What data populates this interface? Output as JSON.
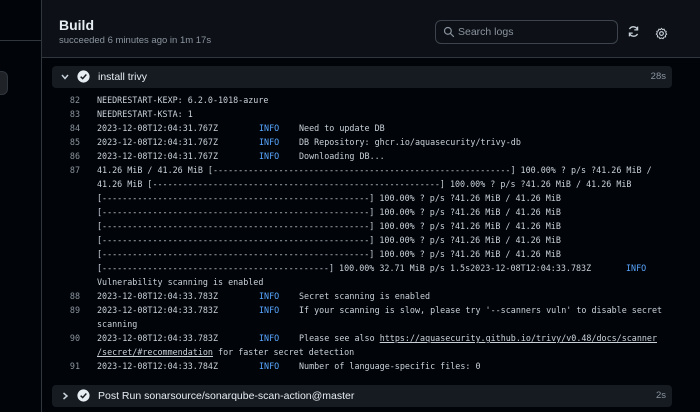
{
  "job": {
    "title": "Build",
    "subtitle": "succeeded 6 minutes ago in 1m 17s"
  },
  "search": {
    "placeholder": "Search logs"
  },
  "icons": {
    "refresh": "refresh-icon",
    "settings": "gear-icon",
    "success": "check-circle-icon",
    "expand": "chevron-down-icon",
    "search": "search-icon"
  },
  "colors": {
    "success": "#e6edf3",
    "info": "#58a6ff",
    "background": "#0d1117"
  },
  "steps": [
    {
      "label": "install trivy",
      "duration": "28s"
    },
    {
      "label": "Post Run sonarsource/sonarqube-scan-action@master",
      "duration": "2s"
    }
  ],
  "log": {
    "l82": {
      "num": "82",
      "text": "NEEDRESTART-KEXP: 6.2.0-1018-azure"
    },
    "l83": {
      "num": "83",
      "text": "NEEDRESTART-KSTA: 1"
    },
    "l84": {
      "num": "84",
      "ts": "2023-12-08T12:04:31.767Z",
      "level": "INFO",
      "msg": "Need to update DB"
    },
    "l85": {
      "num": "85",
      "ts": "2023-12-08T12:04:31.767Z",
      "level": "INFO",
      "msg": "DB Repository: ghcr.io/aquasecurity/trivy-db"
    },
    "l86": {
      "num": "86",
      "ts": "2023-12-08T12:04:31.767Z",
      "level": "INFO",
      "msg": "Downloading DB..."
    },
    "l87": {
      "num": "87",
      "lines": [
        "41.26 MiB / 41.26 MiB [-----------------------------------------------------------] 100.00% ? p/s ?41.26 MiB /",
        "41.26 MiB [---------------------------------------------------------] 100.00% ? p/s ?41.26 MiB / 41.26 MiB",
        "[-----------------------------------------------------] 100.00% ? p/s ?41.26 MiB / 41.26 MiB",
        "[-----------------------------------------------------] 100.00% ? p/s ?41.26 MiB / 41.26 MiB",
        "[-----------------------------------------------------] 100.00% ? p/s ?41.26 MiB / 41.26 MiB",
        "[-----------------------------------------------------] 100.00% ? p/s ?41.26 MiB / 41.26 MiB",
        "[-----------------------------------------------------] 100.00% ? p/s ?41.26 MiB / 41.26 MiB"
      ],
      "last_text": "[---------------------------------------------] 100.00% 32.71 MiB p/s 1.5s2023-12-08T12:04:33.783Z",
      "last_level": "INFO",
      "tail": "Vulnerability scanning is enabled"
    },
    "l88": {
      "num": "88",
      "ts": "2023-12-08T12:04:33.783Z",
      "level": "INFO",
      "msg": "Secret scanning is enabled"
    },
    "l89": {
      "num": "89",
      "ts": "2023-12-08T12:04:33.783Z",
      "level": "INFO",
      "msg": "If your scanning is slow, please try '--scanners vuln' to disable secret",
      "msg2": "scanning"
    },
    "l90": {
      "num": "90",
      "ts": "2023-12-08T12:04:33.783Z",
      "level": "INFO",
      "msg": "Please see also ",
      "link1": "https://aquasecurity.github.io/trivy/v0.48/docs/scanner",
      "link2": "/secret/#recommendation",
      "msg_after": " for faster secret detection"
    },
    "l91": {
      "num": "91",
      "ts": "2023-12-08T12:04:33.784Z",
      "level": "INFO",
      "msg": "Number of language-specific files: 0"
    }
  }
}
